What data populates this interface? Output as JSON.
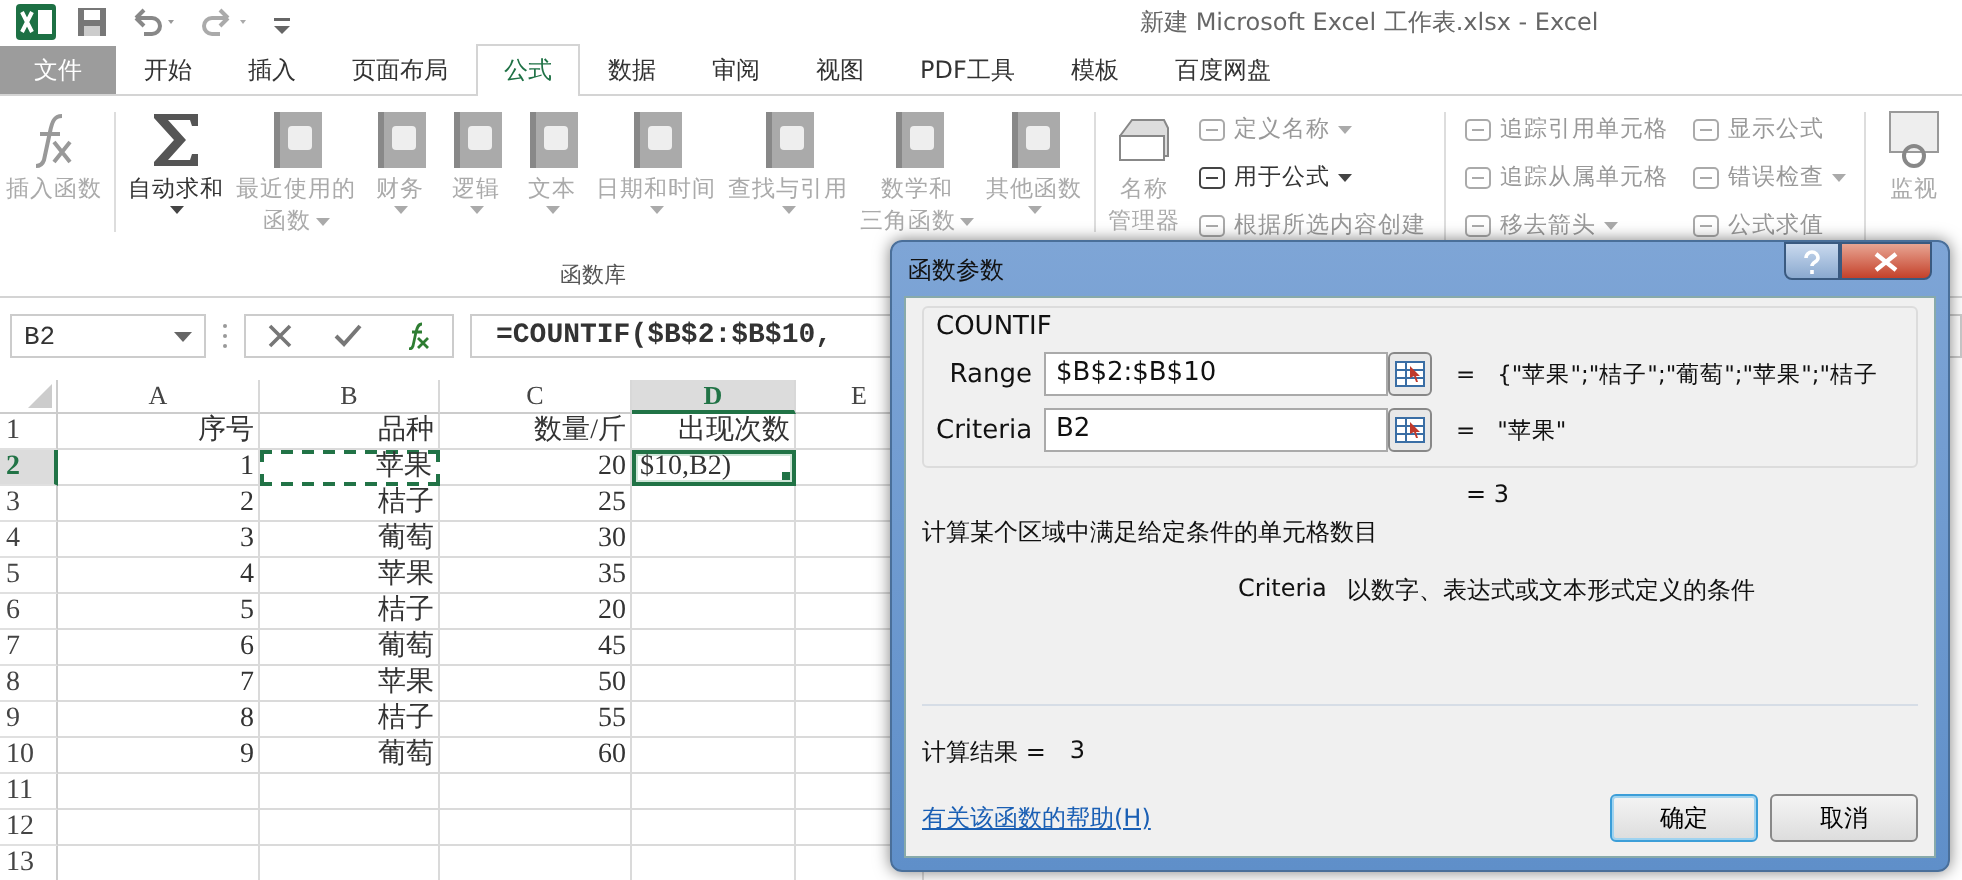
{
  "window": {
    "title": "新建 Microsoft Excel 工作表.xlsx - Excel"
  },
  "tabs": [
    {
      "label": "文件",
      "selected": false,
      "kind": "file"
    },
    {
      "label": "开始",
      "selected": false,
      "kind": "tab"
    },
    {
      "label": "插入",
      "selected": false,
      "kind": "tab"
    },
    {
      "label": "页面布局",
      "selected": false,
      "kind": "tab"
    },
    {
      "label": "公式",
      "selected": true,
      "kind": "tab"
    },
    {
      "label": "数据",
      "selected": false,
      "kind": "tab"
    },
    {
      "label": "审阅",
      "selected": false,
      "kind": "tab"
    },
    {
      "label": "视图",
      "selected": false,
      "kind": "tab"
    },
    {
      "label": "PDF工具",
      "selected": false,
      "kind": "tab"
    },
    {
      "label": "模板",
      "selected": false,
      "kind": "tab"
    },
    {
      "label": "百度网盘",
      "selected": false,
      "kind": "tab"
    }
  ],
  "ribbon": {
    "group_label": "函数库",
    "large_buttons": [
      {
        "label_lines": [
          "插入函数"
        ],
        "disabled": true,
        "dropdown": false
      },
      {
        "label_lines": [
          "自动求和"
        ],
        "disabled": false,
        "dropdown": true
      },
      {
        "label_lines": [
          "最近使用的",
          "函数"
        ],
        "disabled": true,
        "dropdown": true
      },
      {
        "label_lines": [
          "财务"
        ],
        "disabled": true,
        "dropdown": true
      },
      {
        "label_lines": [
          "逻辑"
        ],
        "disabled": true,
        "dropdown": true
      },
      {
        "label_lines": [
          "文本"
        ],
        "disabled": true,
        "dropdown": true
      },
      {
        "label_lines": [
          "日期和时间"
        ],
        "disabled": true,
        "dropdown": true
      },
      {
        "label_lines": [
          "查找与引用"
        ],
        "disabled": true,
        "dropdown": true
      },
      {
        "label_lines": [
          "数学和",
          "三角函数"
        ],
        "disabled": true,
        "dropdown": true
      },
      {
        "label_lines": [
          "其他函数"
        ],
        "disabled": true,
        "dropdown": true
      },
      {
        "label_lines": [
          "名称",
          "管理器"
        ],
        "disabled": true,
        "dropdown": false
      }
    ],
    "small_columns": [
      [
        {
          "label": "定义名称",
          "disabled": true,
          "dropdown": true
        },
        {
          "label": "用于公式",
          "disabled": false,
          "dropdown": true
        },
        {
          "label": "根据所选内容创建",
          "disabled": true,
          "dropdown": false
        }
      ],
      [
        {
          "label": "追踪引用单元格",
          "disabled": true,
          "dropdown": false
        },
        {
          "label": "追踪从属单元格",
          "disabled": true,
          "dropdown": false
        },
        {
          "label": "移去箭头",
          "disabled": true,
          "dropdown": true
        }
      ],
      [
        {
          "label": "显示公式",
          "disabled": true,
          "dropdown": false
        },
        {
          "label": "错误检查",
          "disabled": true,
          "dropdown": true
        },
        {
          "label": "公式求值",
          "disabled": true,
          "dropdown": false
        }
      ]
    ],
    "watch_button": {
      "label": "监视",
      "disabled": true
    }
  },
  "formula_bar": {
    "name_box": "B2",
    "formula": "=COUNTIF($B$2:$B$10,"
  },
  "sheet": {
    "columns": [
      {
        "label": "A",
        "selected": false
      },
      {
        "label": "B",
        "selected": false
      },
      {
        "label": "C",
        "selected": false
      },
      {
        "label": "D",
        "selected": true
      },
      {
        "label": "E",
        "selected": false
      }
    ],
    "rows": [
      {
        "header": "1",
        "selected": false,
        "cells": [
          {
            "text": "序号",
            "active": false,
            "copy_marquee": false
          },
          {
            "text": "品种",
            "active": false,
            "copy_marquee": false
          },
          {
            "text": "数量/斤",
            "active": false,
            "copy_marquee": false
          },
          {
            "text": "出现次数",
            "active": false,
            "copy_marquee": false
          }
        ]
      },
      {
        "header": "2",
        "selected": true,
        "cells": [
          {
            "text": "1",
            "active": false,
            "copy_marquee": false
          },
          {
            "text": "苹果",
            "active": false,
            "copy_marquee": true
          },
          {
            "text": "20",
            "active": false,
            "copy_marquee": false
          },
          {
            "text": "$10,B2)",
            "active": true,
            "copy_marquee": false
          }
        ]
      },
      {
        "header": "3",
        "selected": false,
        "cells": [
          {
            "text": "2",
            "active": false,
            "copy_marquee": false
          },
          {
            "text": "桔子",
            "active": false,
            "copy_marquee": false
          },
          {
            "text": "25",
            "active": false,
            "copy_marquee": false
          }
        ]
      },
      {
        "header": "4",
        "selected": false,
        "cells": [
          {
            "text": "3",
            "active": false,
            "copy_marquee": false
          },
          {
            "text": "葡萄",
            "active": false,
            "copy_marquee": false
          },
          {
            "text": "30",
            "active": false,
            "copy_marquee": false
          }
        ]
      },
      {
        "header": "5",
        "selected": false,
        "cells": [
          {
            "text": "4",
            "active": false,
            "copy_marquee": false
          },
          {
            "text": "苹果",
            "active": false,
            "copy_marquee": false
          },
          {
            "text": "35",
            "active": false,
            "copy_marquee": false
          }
        ]
      },
      {
        "header": "6",
        "selected": false,
        "cells": [
          {
            "text": "5",
            "active": false,
            "copy_marquee": false
          },
          {
            "text": "桔子",
            "active": false,
            "copy_marquee": false
          },
          {
            "text": "20",
            "active": false,
            "copy_marquee": false
          }
        ]
      },
      {
        "header": "7",
        "selected": false,
        "cells": [
          {
            "text": "6",
            "active": false,
            "copy_marquee": false
          },
          {
            "text": "葡萄",
            "active": false,
            "copy_marquee": false
          },
          {
            "text": "45",
            "active": false,
            "copy_marquee": false
          }
        ]
      },
      {
        "header": "8",
        "selected": false,
        "cells": [
          {
            "text": "7",
            "active": false,
            "copy_marquee": false
          },
          {
            "text": "苹果",
            "active": false,
            "copy_marquee": false
          },
          {
            "text": "50",
            "active": false,
            "copy_marquee": false
          }
        ]
      },
      {
        "header": "9",
        "selected": false,
        "cells": [
          {
            "text": "8",
            "active": false,
            "copy_marquee": false
          },
          {
            "text": "桔子",
            "active": false,
            "copy_marquee": false
          },
          {
            "text": "55",
            "active": false,
            "copy_marquee": false
          }
        ]
      },
      {
        "header": "10",
        "selected": false,
        "cells": [
          {
            "text": "9",
            "active": false,
            "copy_marquee": false
          },
          {
            "text": "葡萄",
            "active": false,
            "copy_marquee": false
          },
          {
            "text": "60",
            "active": false,
            "copy_marquee": false
          }
        ]
      },
      {
        "header": "11",
        "selected": false
      },
      {
        "header": "12",
        "selected": false
      },
      {
        "header": "13",
        "selected": false
      }
    ]
  },
  "dialog": {
    "title": "函数参数",
    "function_name": "COUNTIF",
    "arguments": [
      {
        "label": "Range",
        "value": "$B$2:$B$10",
        "result": "= ",
        "result_value": "{\"苹果\";\"桔子\";\"葡萄\";\"苹果\";\"桔子"
      },
      {
        "label": "Criteria",
        "value": "B2",
        "result": "= ",
        "result_value": "\"苹果\""
      }
    ],
    "formula_result": "=   3",
    "description": "计算某个区域中满足给定条件的单元格数目",
    "argument_name": "Criteria",
    "argument_help": "以数字、表达式或文本形式定义的条件",
    "result_label": "计算结果 =",
    "result_value": "3",
    "help_link": "有关该函数的帮助(H)",
    "buttons": [
      {
        "label": "确定",
        "selected": true
      },
      {
        "label": "取消",
        "selected": false
      }
    ]
  }
}
